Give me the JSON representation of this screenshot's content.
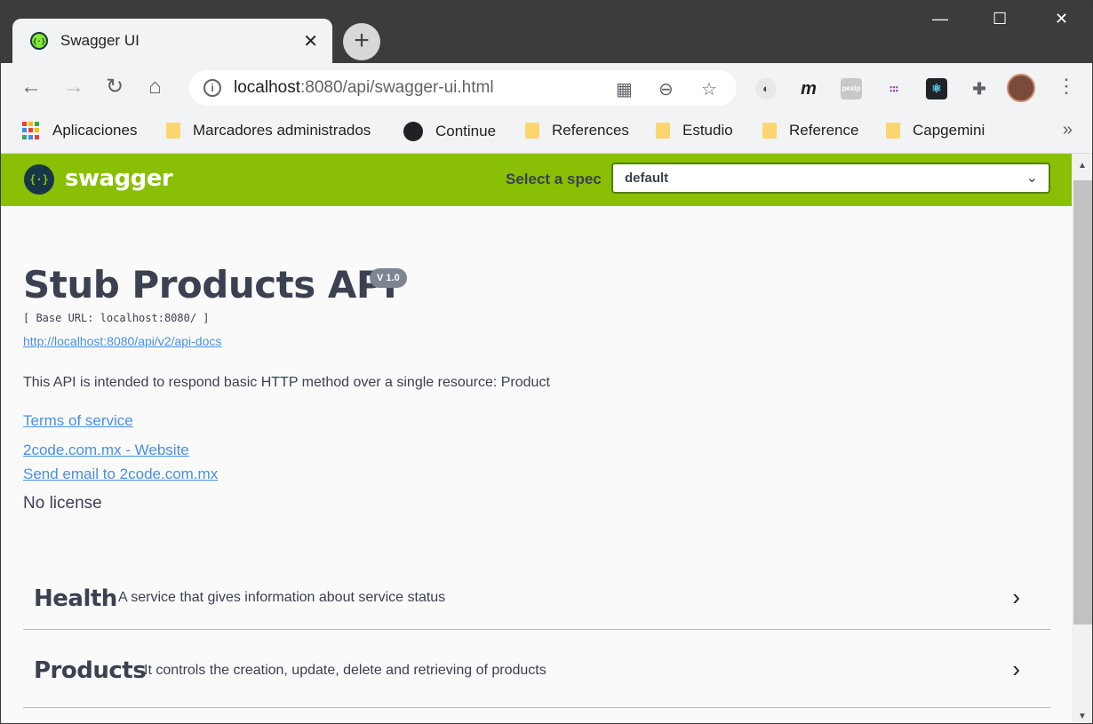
{
  "browser": {
    "tab_title": "Swagger UI",
    "tab_close": "✕",
    "new_tab": "+",
    "window_controls": {
      "minimize": "—",
      "maximize": "☐",
      "close": "✕"
    },
    "url_host": "localhost",
    "url_rest": ":8080/api/swagger-ui.html",
    "bookmarks": [
      "Aplicaciones",
      "Marcadores administrados",
      "Continue",
      "References",
      "Estudio",
      "Reference",
      "Capgemini"
    ],
    "bookmarks_more": "»",
    "extensions": [
      "circle-extension",
      "m-extension",
      "pexip-extension",
      "dots-extension",
      "react-devtools-extension",
      "puzzle-icon"
    ]
  },
  "swagger": {
    "brand": "swagger",
    "spec_label": "Select a spec",
    "spec_selected": "default"
  },
  "info": {
    "title": "Stub Products API",
    "version": "V 1.0",
    "base_url": "[ Base URL: localhost:8080/ ]",
    "docs_url": "http://localhost:8080/api/v2/api-docs",
    "description": "This API is intended to respond basic HTTP method over a single resource: Product",
    "terms": "Terms of service",
    "website": "2code.com.mx - Website",
    "email": "Send email to 2code.com.mx",
    "license": "No license"
  },
  "tags": [
    {
      "name": "Health",
      "description": "A service that gives information about service status"
    },
    {
      "name": "Products",
      "description": "It controls the creation, update, delete and retrieving of products"
    }
  ],
  "colors": {
    "swagger_green": "#89bf04",
    "link": "#4990e2",
    "text": "#3b4151"
  }
}
